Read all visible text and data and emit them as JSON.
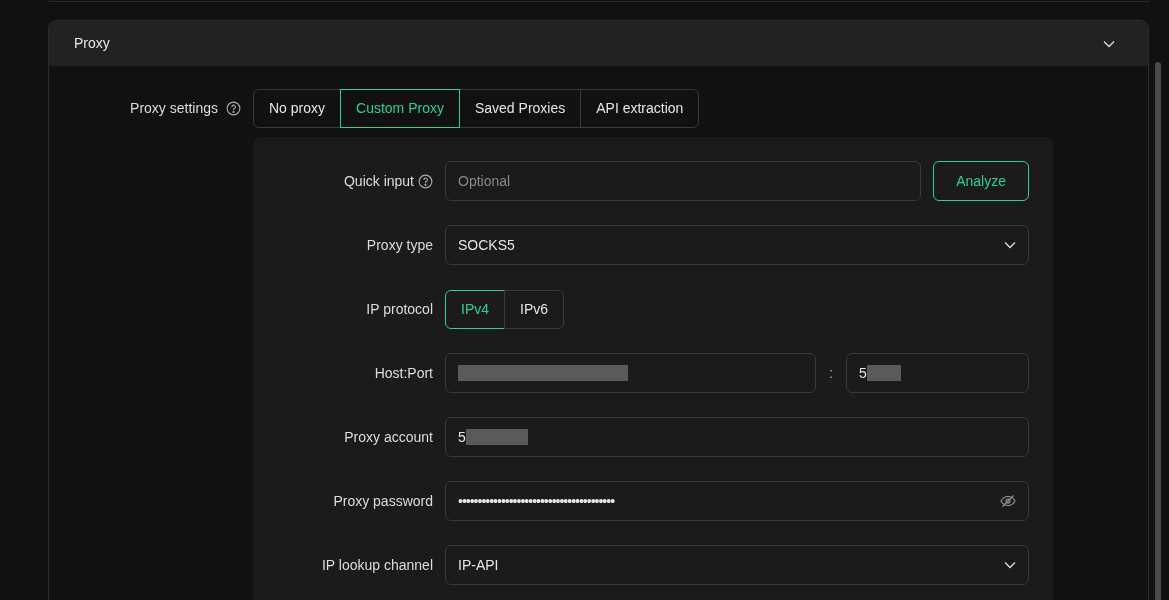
{
  "section": {
    "title": "Proxy",
    "expanded": true
  },
  "proxy_settings": {
    "label": "Proxy settings",
    "tabs": [
      {
        "label": "No proxy",
        "selected": false
      },
      {
        "label": "Custom Proxy",
        "selected": true
      },
      {
        "label": "Saved Proxies",
        "selected": false
      },
      {
        "label": "API extraction",
        "selected": false
      }
    ]
  },
  "form": [
    {
      "kind": "quick",
      "label": "Quick input",
      "placeholder": "Optional",
      "button": "Analyze"
    },
    {
      "kind": "select",
      "label": "Proxy type",
      "value": "SOCKS5"
    },
    {
      "kind": "segmented",
      "label": "IP protocol",
      "options": [
        {
          "label": "IPv4",
          "selected": true
        },
        {
          "label": "IPv6",
          "selected": false
        }
      ]
    },
    {
      "kind": "hostport",
      "label": "Host:Port",
      "separator": ":",
      "port": "5"
    },
    {
      "kind": "text",
      "label": "Proxy account",
      "value": "5"
    },
    {
      "kind": "password",
      "label": "Proxy password",
      "value": "••••••••••••••••••••••••••••••••••••••••"
    },
    {
      "kind": "select",
      "label": "IP lookup channel",
      "value": "IP-API"
    }
  ]
}
